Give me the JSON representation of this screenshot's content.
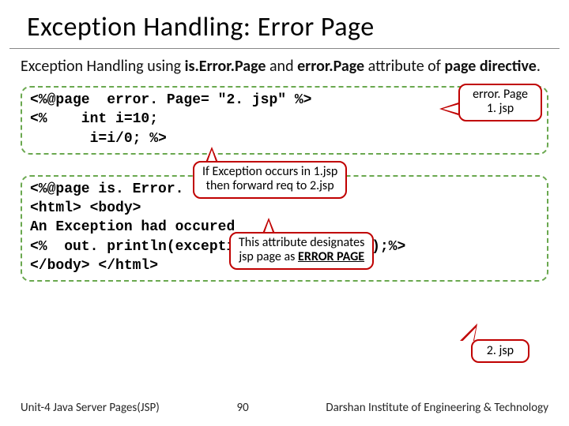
{
  "title": "Exception Handling: Error Page",
  "intro_prefix": "Exception Handling using ",
  "intro_b1": "is.Error.Page",
  "intro_mid": " and ",
  "intro_b2": "error.Page",
  "intro_suffix": " attribute of ",
  "intro_b3": "page directive",
  "intro_period": ".",
  "code1": {
    "l1": "<%@page  error. Page= \"2. jsp\" %>",
    "l2": "<%    int i=10;",
    "l3": "       i=i/0; %>"
  },
  "callout1a_l1": "error. Page",
  "callout1a_l2": "1. jsp",
  "callout1b_l1": "If Exception occurs in 1.jsp",
  "callout1b_l2": "then forward req to 2.jsp",
  "code2": {
    "l1": "<%@page is. Error. Page=\"true\" %>",
    "l2": "<html> <body>",
    "l3": "An Exception had occured",
    "l4": "<%  out. println(exception. to. String());%>",
    "l5": "</body> </html>"
  },
  "callout2_l1": "This attribute designates",
  "callout2_l2a": "jsp page as ",
  "callout2_l2b": "ERROR PAGE",
  "callout3": "2. jsp",
  "footer": {
    "left": "Unit-4 Java Server Pages(JSP)",
    "page": "90",
    "right": "Darshan Institute of Engineering & Technology"
  }
}
